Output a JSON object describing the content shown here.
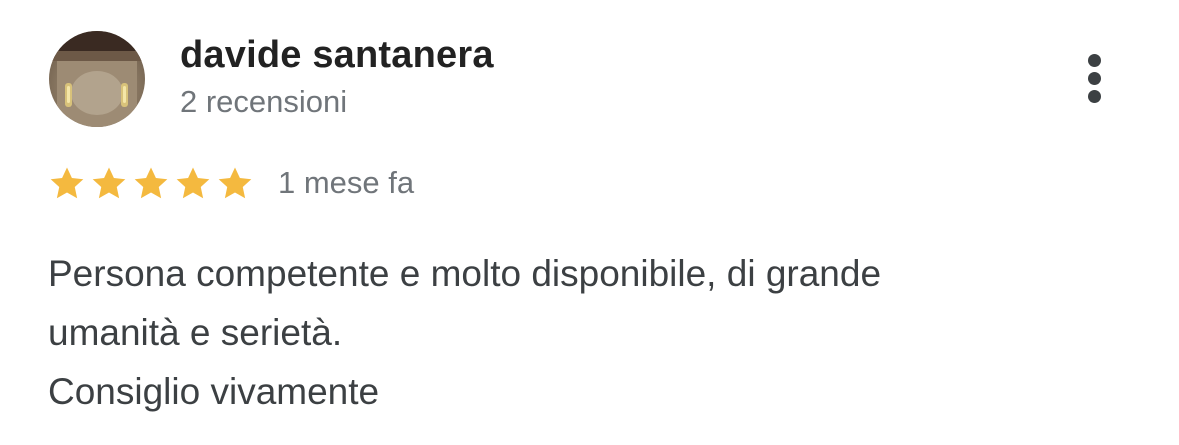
{
  "review": {
    "author_name": "davide santanera",
    "review_count": "2 recensioni",
    "rating": 5,
    "rating_max": 5,
    "date": "1 mese fa",
    "text_lines": [
      "Persona competente e molto disponibile, di grande",
      "umanità e serietà.",
      "Consiglio vivamente"
    ]
  },
  "icons": {
    "avatar": "avatar-photo",
    "more": "more-vert-icon",
    "star": "star-icon"
  },
  "colors": {
    "star": "#f4b93f",
    "name": "#222222",
    "meta": "#70757a",
    "body": "#3c4043"
  }
}
